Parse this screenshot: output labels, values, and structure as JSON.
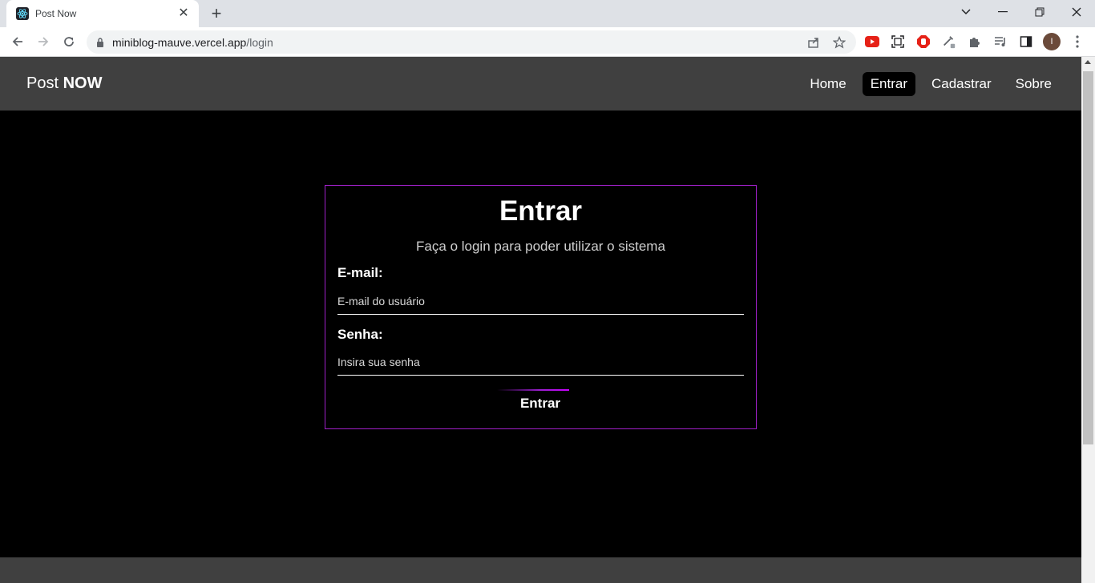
{
  "browser": {
    "tab_title": "Post Now",
    "url_host": "miniblog-mauve.vercel.app",
    "url_path": "/login",
    "avatar_initial": "I"
  },
  "site": {
    "brand_regular": "Post ",
    "brand_bold": "NOW",
    "nav": [
      {
        "label": "Home",
        "active": false
      },
      {
        "label": "Entrar",
        "active": true
      },
      {
        "label": "Cadastrar",
        "active": false
      },
      {
        "label": "Sobre",
        "active": false
      }
    ]
  },
  "login": {
    "title": "Entrar",
    "subtitle": "Faça o login para poder utilizar o sistema",
    "email_label": "E-mail:",
    "email_placeholder": "E-mail do usuário",
    "email_value": "",
    "password_label": "Senha:",
    "password_placeholder": "Insira sua senha",
    "password_value": "",
    "submit_label": "Entrar"
  },
  "colors": {
    "nav_bg": "#404040",
    "page_bg": "#000000",
    "accent": "#a020c8"
  }
}
